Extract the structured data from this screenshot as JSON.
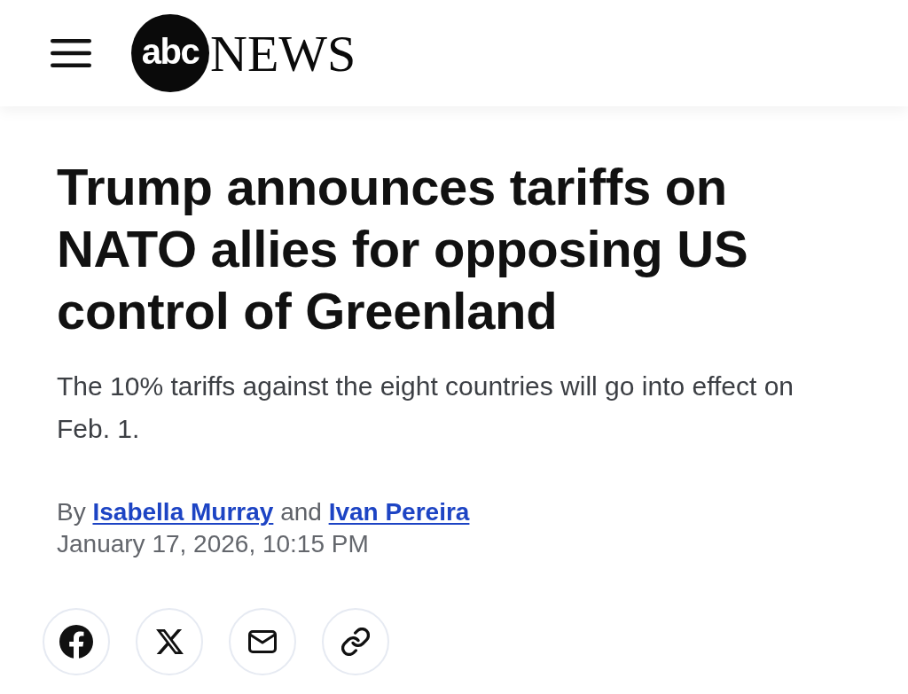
{
  "header": {
    "logo": {
      "mark": "abc",
      "wordmark": "NEWS"
    }
  },
  "article": {
    "headline": "Trump announces tariffs on NATO allies for opposing US control of Greenland",
    "subheadline": "The 10% tariffs against the eight countries will go into effect on Feb. 1.",
    "byline": {
      "prefix": "By",
      "authors": [
        "Isabella Murray",
        "Ivan Pereira"
      ],
      "conjunction": "and"
    },
    "timestamp": "January 17, 2026, 10:15 PM"
  },
  "share_buttons": [
    {
      "kind": "facebook"
    },
    {
      "kind": "x"
    },
    {
      "kind": "email"
    },
    {
      "kind": "link"
    }
  ]
}
